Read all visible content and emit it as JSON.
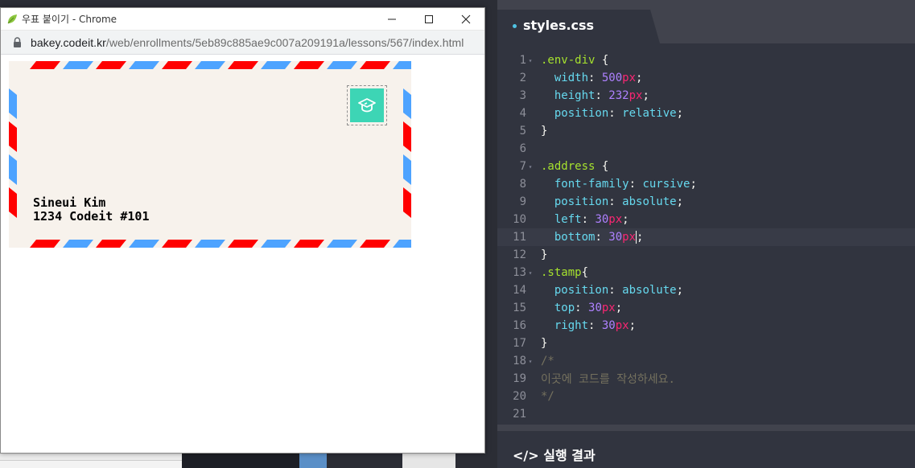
{
  "browser": {
    "title": "우표 붙이기 - Chrome",
    "url_host": "bakey.codeit.kr",
    "url_path": "/web/enrollments/5eb89c885ae9c007a209191a/lessons/567/index.html"
  },
  "envelope": {
    "name": "Sineui Kim",
    "address": "1234 Codeit #101",
    "stamp_icon": "graduation-cap-icon",
    "colors": {
      "paper": "#f7f2ec",
      "red": "#ff0000",
      "blue": "#4da3ff",
      "stamp": "#3dd5b5"
    }
  },
  "editor": {
    "tab_label": "styles.css",
    "result_label": "</> 실행 결과",
    "active_line": 11,
    "lines": [
      {
        "n": "1",
        "fold": true,
        "tokens": [
          [
            "sel",
            ".env-div"
          ],
          [
            "pun",
            " {"
          ]
        ]
      },
      {
        "n": "2",
        "fold": false,
        "tokens": [
          [
            "pun",
            "  "
          ],
          [
            "prop",
            "width"
          ],
          [
            "pun",
            ": "
          ],
          [
            "num",
            "500"
          ],
          [
            "unit",
            "px"
          ],
          [
            "pun",
            ";"
          ]
        ]
      },
      {
        "n": "3",
        "fold": false,
        "tokens": [
          [
            "pun",
            "  "
          ],
          [
            "prop",
            "height"
          ],
          [
            "pun",
            ": "
          ],
          [
            "num",
            "232"
          ],
          [
            "unit",
            "px"
          ],
          [
            "pun",
            ";"
          ]
        ]
      },
      {
        "n": "4",
        "fold": false,
        "tokens": [
          [
            "pun",
            "  "
          ],
          [
            "prop",
            "position"
          ],
          [
            "pun",
            ": "
          ],
          [
            "kw",
            "relative"
          ],
          [
            "pun",
            ";"
          ]
        ]
      },
      {
        "n": "5",
        "fold": false,
        "tokens": [
          [
            "pun",
            "}"
          ]
        ]
      },
      {
        "n": "6",
        "fold": false,
        "tokens": []
      },
      {
        "n": "7",
        "fold": true,
        "tokens": [
          [
            "sel",
            ".address"
          ],
          [
            "pun",
            " {"
          ]
        ]
      },
      {
        "n": "8",
        "fold": false,
        "tokens": [
          [
            "pun",
            "  "
          ],
          [
            "prop",
            "font-family"
          ],
          [
            "pun",
            ": "
          ],
          [
            "kw",
            "cursive"
          ],
          [
            "pun",
            ";"
          ]
        ]
      },
      {
        "n": "9",
        "fold": false,
        "tokens": [
          [
            "pun",
            "  "
          ],
          [
            "prop",
            "position"
          ],
          [
            "pun",
            ": "
          ],
          [
            "kw",
            "absolute"
          ],
          [
            "pun",
            ";"
          ]
        ]
      },
      {
        "n": "10",
        "fold": false,
        "tokens": [
          [
            "pun",
            "  "
          ],
          [
            "prop",
            "left"
          ],
          [
            "pun",
            ": "
          ],
          [
            "num",
            "30"
          ],
          [
            "unit",
            "px"
          ],
          [
            "pun",
            ";"
          ]
        ]
      },
      {
        "n": "11",
        "fold": false,
        "tokens": [
          [
            "pun",
            "  "
          ],
          [
            "prop",
            "bottom"
          ],
          [
            "pun",
            ": "
          ],
          [
            "num",
            "30"
          ],
          [
            "unit",
            "px"
          ],
          [
            "cursor",
            ""
          ],
          [
            "pun",
            ";"
          ]
        ]
      },
      {
        "n": "12",
        "fold": false,
        "tokens": [
          [
            "pun",
            "}"
          ]
        ]
      },
      {
        "n": "13",
        "fold": true,
        "tokens": [
          [
            "sel",
            ".stamp"
          ],
          [
            "pun",
            "{"
          ]
        ]
      },
      {
        "n": "14",
        "fold": false,
        "tokens": [
          [
            "pun",
            "  "
          ],
          [
            "prop",
            "position"
          ],
          [
            "pun",
            ": "
          ],
          [
            "kw",
            "absolute"
          ],
          [
            "pun",
            ";"
          ]
        ]
      },
      {
        "n": "15",
        "fold": false,
        "tokens": [
          [
            "pun",
            "  "
          ],
          [
            "prop",
            "top"
          ],
          [
            "pun",
            ": "
          ],
          [
            "num",
            "30"
          ],
          [
            "unit",
            "px"
          ],
          [
            "pun",
            ";"
          ]
        ]
      },
      {
        "n": "16",
        "fold": false,
        "tokens": [
          [
            "pun",
            "  "
          ],
          [
            "prop",
            "right"
          ],
          [
            "pun",
            ": "
          ],
          [
            "num",
            "30"
          ],
          [
            "unit",
            "px"
          ],
          [
            "pun",
            ";"
          ]
        ]
      },
      {
        "n": "17",
        "fold": false,
        "tokens": [
          [
            "pun",
            "}"
          ]
        ]
      },
      {
        "n": "18",
        "fold": true,
        "tokens": [
          [
            "cmt",
            "/*"
          ]
        ]
      },
      {
        "n": "19",
        "fold": false,
        "tokens": [
          [
            "cmt",
            "이곳에 코드를 작성하세요."
          ]
        ]
      },
      {
        "n": "20",
        "fold": false,
        "tokens": [
          [
            "cmt",
            "*/"
          ]
        ]
      },
      {
        "n": "21",
        "fold": false,
        "tokens": []
      }
    ]
  }
}
